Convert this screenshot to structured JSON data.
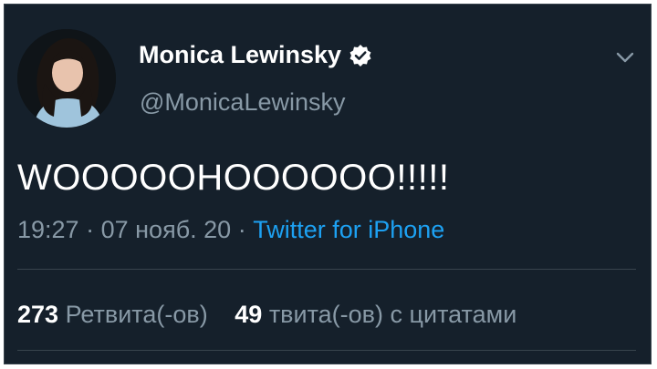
{
  "tweet": {
    "author": {
      "display_name": "Monica Lewinsky",
      "handle": "@MonicaLewinsky",
      "verified_icon": "verified-badge-icon",
      "avatar_icon": "profile-photo"
    },
    "menu_icon": "chevron-down-icon",
    "text": "WOOOOOHOOOOOO!!!!!",
    "time": "19:27",
    "separator": "·",
    "date": "07 нояб. 20",
    "source": "Twitter for iPhone",
    "stats": {
      "retweets_count": "273",
      "retweets_label": "Ретвита(-ов)",
      "quotes_count": "49",
      "quotes_label": "твита(-ов) с цитатами"
    }
  },
  "colors": {
    "background": "#15202b",
    "text_primary": "#ffffff",
    "text_secondary": "#8899a6",
    "link": "#1da1f2",
    "divider": "#38444d"
  }
}
